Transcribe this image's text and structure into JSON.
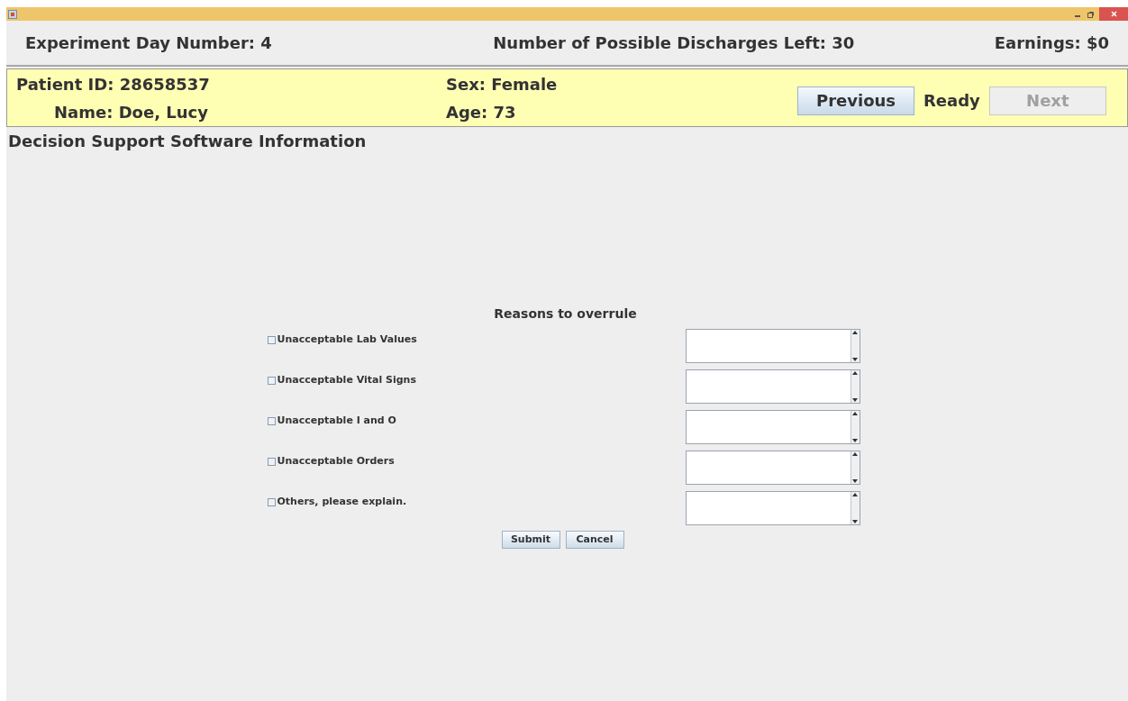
{
  "header": {
    "day": "Experiment Day Number: 4",
    "discharges": "Number of Possible Discharges Left: 30",
    "earnings": "Earnings: $0"
  },
  "patient": {
    "id": "Patient ID: 28658537",
    "name": "Name: Doe, Lucy",
    "sex": "Sex: Female",
    "age": "Age: 73"
  },
  "nav": {
    "previous": {
      "label": "Previous",
      "disabled": false
    },
    "status": "Ready",
    "next": {
      "label": "Next",
      "disabled": true
    }
  },
  "section_title": "Decision Support Software Information",
  "reasons": {
    "title": "Reasons to overrule",
    "items": [
      {
        "label": "Unacceptable Lab Values",
        "checked": false
      },
      {
        "label": "Unacceptable Vital Signs",
        "checked": false
      },
      {
        "label": "Unacceptable I and O",
        "checked": false
      },
      {
        "label": "Unacceptable Orders",
        "checked": false
      },
      {
        "label": "Others, please explain.",
        "checked": false
      }
    ],
    "buttons": [
      "Submit",
      "Cancel"
    ]
  }
}
